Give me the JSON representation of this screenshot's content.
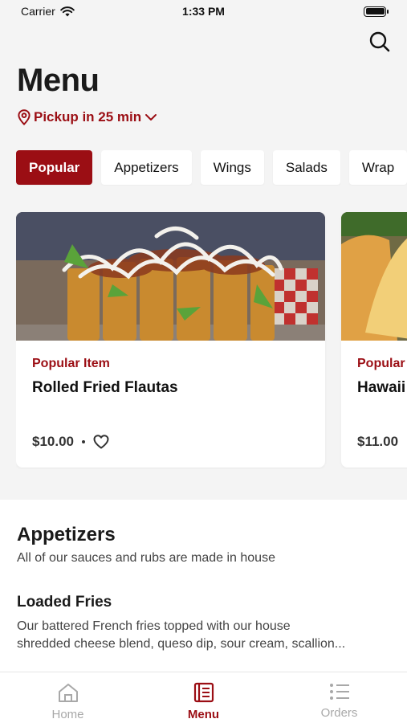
{
  "status_bar": {
    "carrier": "Carrier",
    "time": "1:33 PM"
  },
  "header": {
    "title": "Menu",
    "pickup_label": "Pickup in 25 min",
    "search_icon": "search-icon"
  },
  "categories": [
    {
      "label": "Popular",
      "active": true
    },
    {
      "label": "Appetizers",
      "active": false
    },
    {
      "label": "Wings",
      "active": false
    },
    {
      "label": "Salads",
      "active": false
    },
    {
      "label": "Wrap",
      "active": false
    }
  ],
  "featured": [
    {
      "tag": "Popular Item",
      "name": "Rolled Fried Flautas",
      "price": "$10.00"
    },
    {
      "tag": "Popular Item",
      "name": "Hawaii",
      "price": "$11.00"
    }
  ],
  "section": {
    "title": "Appetizers",
    "subtitle": "All of our sauces and rubs are made in house",
    "item_name": "Loaded Fries",
    "item_desc_line1": "Our battered French fries topped with our house",
    "item_desc_line2": "shredded cheese blend, queso dip, sour cream, scallion..."
  },
  "tabbar": {
    "home": "Home",
    "menu": "Menu",
    "orders": "Orders"
  },
  "colors": {
    "brand": "#9b0e14",
    "background": "#f4f4f4",
    "inactive": "#a8a8a8"
  }
}
